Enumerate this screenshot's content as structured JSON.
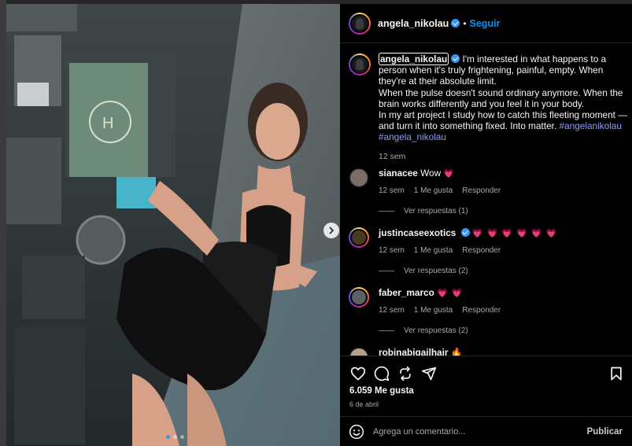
{
  "post": {
    "username": "angela_nikolau",
    "follow_label": "Seguir",
    "separator": "•",
    "carousel": {
      "total": 3,
      "active": 1
    }
  },
  "caption": {
    "username": "angela_nikolau",
    "text_1": " I'm interested in what happens to a person when it's truly frightening, painful, empty. When they're at their absolute limit.",
    "text_2": "When the pulse doesn't sound ordinary anymore. When the brain works differently and you feel it in your body.",
    "text_3": "In my art project I study how to catch this fleeting moment — and turn it into something fixed. Into matter. ",
    "hashtag_1": "#angelanikolau",
    "hashtag_2": "#angela_nikolau",
    "time": "12 sem"
  },
  "comments": [
    {
      "username": "sianacee",
      "text": "Wow ",
      "hearts": "💗",
      "time": "12 sem",
      "likes": "1 Me gusta",
      "reply": "Responder",
      "view_replies": "Ver respuestas (1)"
    },
    {
      "username": "justincaseexotics",
      "text": "",
      "hearts": "💗 💗 💗 💗 💗 💗",
      "time": "12 sem",
      "likes": "1 Me gusta",
      "reply": "Responder",
      "view_replies": "Ver respuestas (2)"
    },
    {
      "username": "faber_marco",
      "text": "",
      "hearts": "💗 💗",
      "time": "12 sem",
      "likes": "1 Me gusta",
      "reply": "Responder",
      "view_replies": "Ver respuestas (2)"
    },
    {
      "username": "robinabigailhair",
      "text": "",
      "hearts": "🔥",
      "time": "",
      "likes": "",
      "reply": "",
      "view_replies": ""
    }
  ],
  "actions": {
    "icons": [
      "heart-icon",
      "comment-icon",
      "repost-icon",
      "share-icon",
      "bookmark-icon"
    ],
    "likes_count": "6.059 Me gusta",
    "date": "6 de abril"
  },
  "comment_box": {
    "placeholder": "Agrega un comentario...",
    "publish_label": "Publicar"
  },
  "colors": {
    "accent_blue": "#0095f6",
    "hashtag": "#8c9df5",
    "heart": "#ff3040",
    "panel_bg": "#000000"
  }
}
